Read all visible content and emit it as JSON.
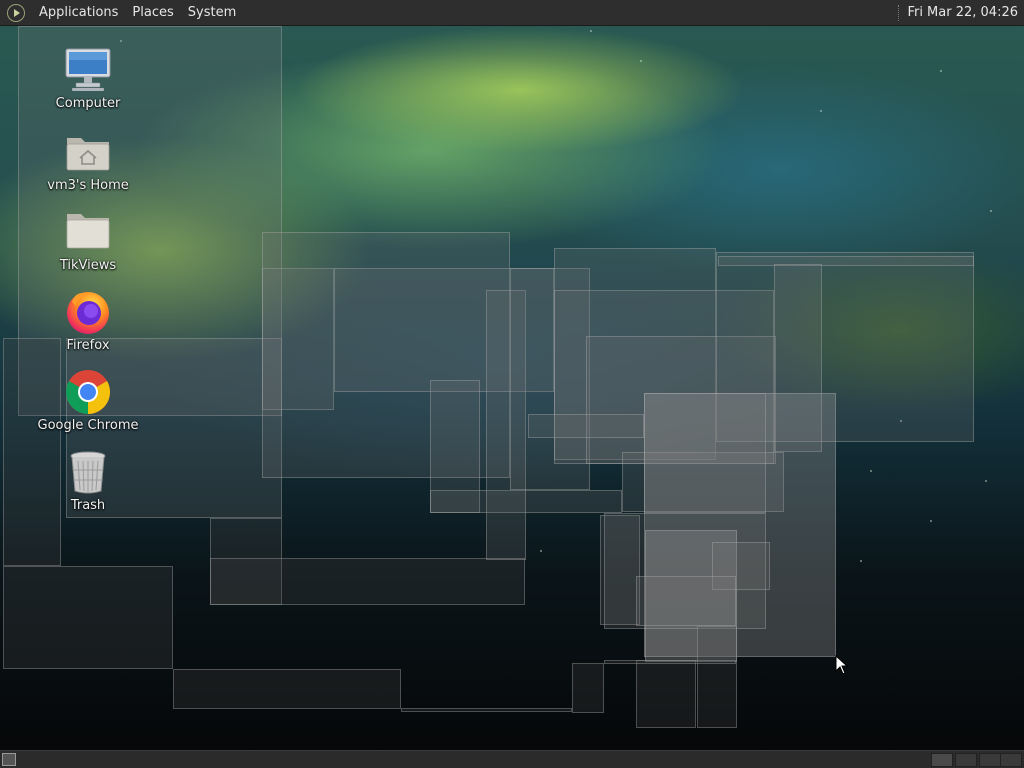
{
  "panel": {
    "menu": [
      "Applications",
      "Places",
      "System"
    ],
    "clock": "Fri Mar 22, 04:26"
  },
  "desktop": {
    "icons": [
      {
        "label": "Computer",
        "icon": "computer-icon"
      },
      {
        "label": "vm3's Home",
        "icon": "home-folder-icon"
      },
      {
        "label": "TikViews",
        "icon": "folder-icon"
      },
      {
        "label": "Firefox",
        "icon": "firefox-icon"
      },
      {
        "label": "Google Chrome",
        "icon": "chrome-icon"
      },
      {
        "label": "Trash",
        "icon": "trash-icon"
      }
    ]
  },
  "colors": {
    "panel_bg": "#2e2e2e",
    "panel_text": "#e6e6e6",
    "label_text": "#f2f2f2"
  }
}
